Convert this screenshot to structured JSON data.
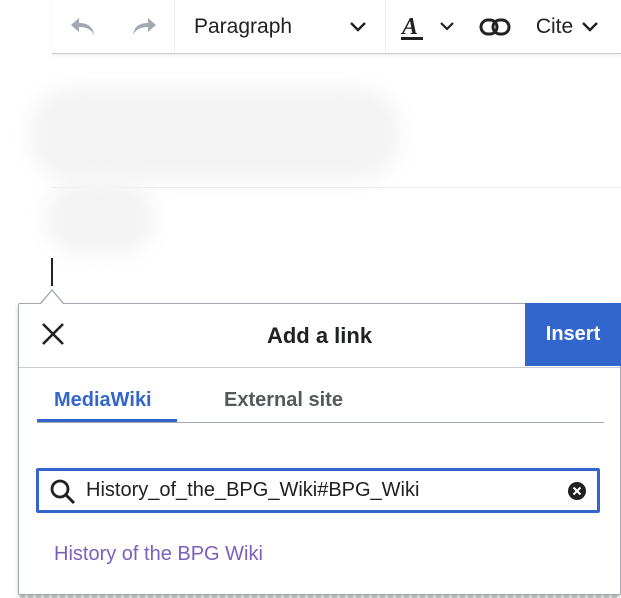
{
  "toolbar": {
    "undo_icon": "undo-icon",
    "redo_icon": "redo-icon",
    "format_label": "Paragraph",
    "text_style_icon": "text-style-icon",
    "link_icon": "link-icon",
    "cite_label": "Cite"
  },
  "dialog": {
    "title": "Add a link",
    "insert_label": "Insert",
    "close_icon": "close-icon",
    "tabs": [
      {
        "label": "MediaWiki",
        "active": true
      },
      {
        "label": "External site",
        "active": false
      }
    ],
    "search": {
      "value": "History_of_the_BPG_Wiki#BPG_Wiki"
    },
    "results": [
      {
        "label": "History of the BPG Wiki"
      }
    ]
  },
  "colors": {
    "accent": "#3366cc",
    "visited_link": "#7b5fbd",
    "text": "#202122"
  }
}
